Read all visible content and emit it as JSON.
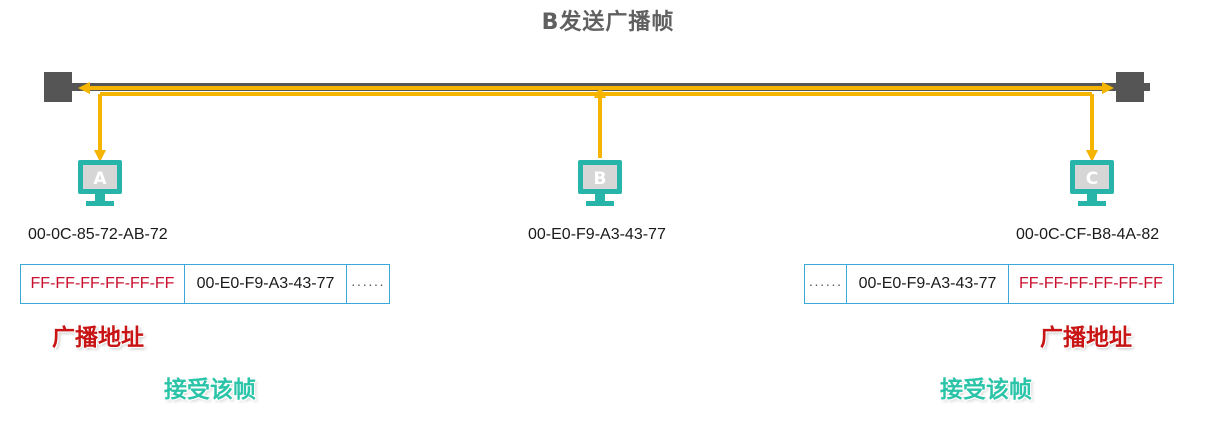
{
  "title": "B发送广播帧",
  "hosts": {
    "a": {
      "letter": "A",
      "mac": "00-0C-85-72-AB-72"
    },
    "b": {
      "letter": "B",
      "mac": "00-E0-F9-A3-43-77"
    },
    "c": {
      "letter": "C",
      "mac": "00-0C-CF-B8-4A-82"
    }
  },
  "frame_left": {
    "dest": "FF-FF-FF-FF-FF-FF",
    "src": "00-E0-F9-A3-43-77",
    "rest": "······"
  },
  "frame_right": {
    "rest": "······",
    "src": "00-E0-F9-A3-43-77",
    "dest": "FF-FF-FF-FF-FF-FF"
  },
  "labels": {
    "broadcast_left": "广播地址",
    "broadcast_right": "广播地址",
    "accept_left": "接受该帧",
    "accept_right": "接受该帧"
  },
  "colors": {
    "bus": "#555555",
    "signal": "#f5b400",
    "monitor": "#26b5a8",
    "broadcast_text": "#c81414",
    "accept_text": "#2cc4a8",
    "frame_border": "#3aa8d8"
  }
}
